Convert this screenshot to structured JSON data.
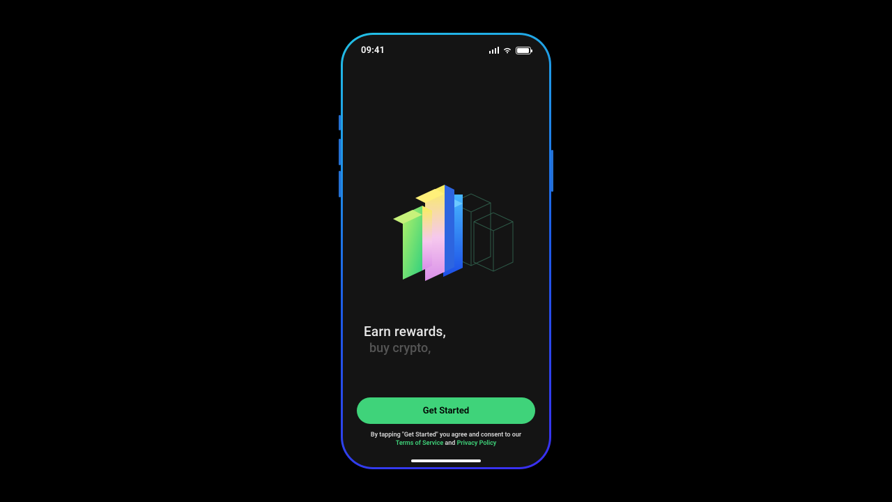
{
  "status": {
    "time": "09:41"
  },
  "headline": {
    "line1": "Earn rewards,",
    "line2": "buy crypto,"
  },
  "cta": {
    "label": "Get Started"
  },
  "legal": {
    "prefix": "By tapping \"Get Started\" you agree and consent to our",
    "tos": "Terms of Service",
    "and": " and ",
    "privacy": "Privacy Policy"
  },
  "colors": {
    "accent": "#3fd37a"
  }
}
